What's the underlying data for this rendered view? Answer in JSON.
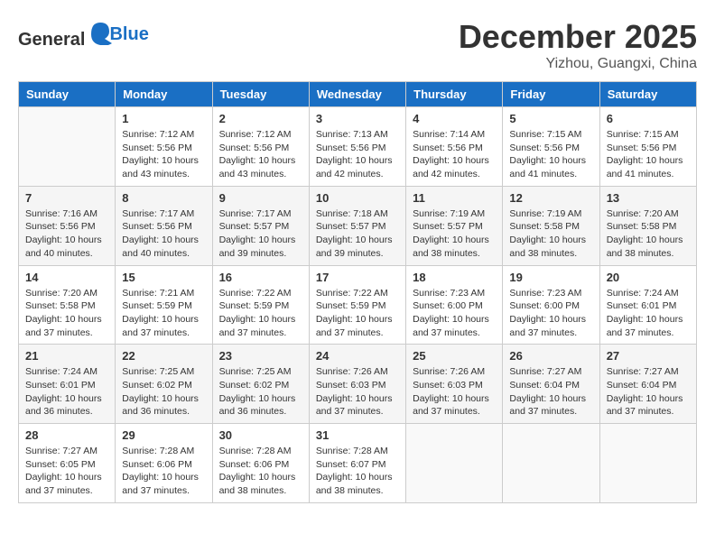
{
  "header": {
    "logo_general": "General",
    "logo_blue": "Blue",
    "month": "December 2025",
    "location": "Yizhou, Guangxi, China"
  },
  "days_of_week": [
    "Sunday",
    "Monday",
    "Tuesday",
    "Wednesday",
    "Thursday",
    "Friday",
    "Saturday"
  ],
  "weeks": [
    [
      {
        "day": "",
        "info": ""
      },
      {
        "day": "1",
        "info": "Sunrise: 7:12 AM\nSunset: 5:56 PM\nDaylight: 10 hours and 43 minutes."
      },
      {
        "day": "2",
        "info": "Sunrise: 7:12 AM\nSunset: 5:56 PM\nDaylight: 10 hours and 43 minutes."
      },
      {
        "day": "3",
        "info": "Sunrise: 7:13 AM\nSunset: 5:56 PM\nDaylight: 10 hours and 42 minutes."
      },
      {
        "day": "4",
        "info": "Sunrise: 7:14 AM\nSunset: 5:56 PM\nDaylight: 10 hours and 42 minutes."
      },
      {
        "day": "5",
        "info": "Sunrise: 7:15 AM\nSunset: 5:56 PM\nDaylight: 10 hours and 41 minutes."
      },
      {
        "day": "6",
        "info": "Sunrise: 7:15 AM\nSunset: 5:56 PM\nDaylight: 10 hours and 41 minutes."
      }
    ],
    [
      {
        "day": "7",
        "info": "Sunrise: 7:16 AM\nSunset: 5:56 PM\nDaylight: 10 hours and 40 minutes."
      },
      {
        "day": "8",
        "info": "Sunrise: 7:17 AM\nSunset: 5:56 PM\nDaylight: 10 hours and 40 minutes."
      },
      {
        "day": "9",
        "info": "Sunrise: 7:17 AM\nSunset: 5:57 PM\nDaylight: 10 hours and 39 minutes."
      },
      {
        "day": "10",
        "info": "Sunrise: 7:18 AM\nSunset: 5:57 PM\nDaylight: 10 hours and 39 minutes."
      },
      {
        "day": "11",
        "info": "Sunrise: 7:19 AM\nSunset: 5:57 PM\nDaylight: 10 hours and 38 minutes."
      },
      {
        "day": "12",
        "info": "Sunrise: 7:19 AM\nSunset: 5:58 PM\nDaylight: 10 hours and 38 minutes."
      },
      {
        "day": "13",
        "info": "Sunrise: 7:20 AM\nSunset: 5:58 PM\nDaylight: 10 hours and 38 minutes."
      }
    ],
    [
      {
        "day": "14",
        "info": "Sunrise: 7:20 AM\nSunset: 5:58 PM\nDaylight: 10 hours and 37 minutes."
      },
      {
        "day": "15",
        "info": "Sunrise: 7:21 AM\nSunset: 5:59 PM\nDaylight: 10 hours and 37 minutes."
      },
      {
        "day": "16",
        "info": "Sunrise: 7:22 AM\nSunset: 5:59 PM\nDaylight: 10 hours and 37 minutes."
      },
      {
        "day": "17",
        "info": "Sunrise: 7:22 AM\nSunset: 5:59 PM\nDaylight: 10 hours and 37 minutes."
      },
      {
        "day": "18",
        "info": "Sunrise: 7:23 AM\nSunset: 6:00 PM\nDaylight: 10 hours and 37 minutes."
      },
      {
        "day": "19",
        "info": "Sunrise: 7:23 AM\nSunset: 6:00 PM\nDaylight: 10 hours and 37 minutes."
      },
      {
        "day": "20",
        "info": "Sunrise: 7:24 AM\nSunset: 6:01 PM\nDaylight: 10 hours and 37 minutes."
      }
    ],
    [
      {
        "day": "21",
        "info": "Sunrise: 7:24 AM\nSunset: 6:01 PM\nDaylight: 10 hours and 36 minutes."
      },
      {
        "day": "22",
        "info": "Sunrise: 7:25 AM\nSunset: 6:02 PM\nDaylight: 10 hours and 36 minutes."
      },
      {
        "day": "23",
        "info": "Sunrise: 7:25 AM\nSunset: 6:02 PM\nDaylight: 10 hours and 36 minutes."
      },
      {
        "day": "24",
        "info": "Sunrise: 7:26 AM\nSunset: 6:03 PM\nDaylight: 10 hours and 37 minutes."
      },
      {
        "day": "25",
        "info": "Sunrise: 7:26 AM\nSunset: 6:03 PM\nDaylight: 10 hours and 37 minutes."
      },
      {
        "day": "26",
        "info": "Sunrise: 7:27 AM\nSunset: 6:04 PM\nDaylight: 10 hours and 37 minutes."
      },
      {
        "day": "27",
        "info": "Sunrise: 7:27 AM\nSunset: 6:04 PM\nDaylight: 10 hours and 37 minutes."
      }
    ],
    [
      {
        "day": "28",
        "info": "Sunrise: 7:27 AM\nSunset: 6:05 PM\nDaylight: 10 hours and 37 minutes."
      },
      {
        "day": "29",
        "info": "Sunrise: 7:28 AM\nSunset: 6:06 PM\nDaylight: 10 hours and 37 minutes."
      },
      {
        "day": "30",
        "info": "Sunrise: 7:28 AM\nSunset: 6:06 PM\nDaylight: 10 hours and 38 minutes."
      },
      {
        "day": "31",
        "info": "Sunrise: 7:28 AM\nSunset: 6:07 PM\nDaylight: 10 hours and 38 minutes."
      },
      {
        "day": "",
        "info": ""
      },
      {
        "day": "",
        "info": ""
      },
      {
        "day": "",
        "info": ""
      }
    ]
  ]
}
